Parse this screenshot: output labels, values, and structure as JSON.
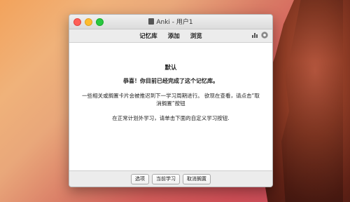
{
  "window": {
    "title": "Anki - 用户1"
  },
  "menu": {
    "items": [
      "记忆库",
      "添加",
      "浏览"
    ],
    "stats_icon": "bar-chart-icon",
    "settings_icon": "gear-icon"
  },
  "content": {
    "deck_name": "默认",
    "congrats": "恭喜！你目前已经完成了这个记忆库。",
    "info_line1": "一些相关或搁置卡片会被推迟到下一学习周期进行。 欲现在查看，请点击“取",
    "info_line2": "消搁置”按钮",
    "custom_study": "在正常计划外学习，请单击下面的自定义学习按钮."
  },
  "buttons": {
    "options": "选项",
    "custom_study": "当前学习",
    "unbury": "取消搁置"
  }
}
